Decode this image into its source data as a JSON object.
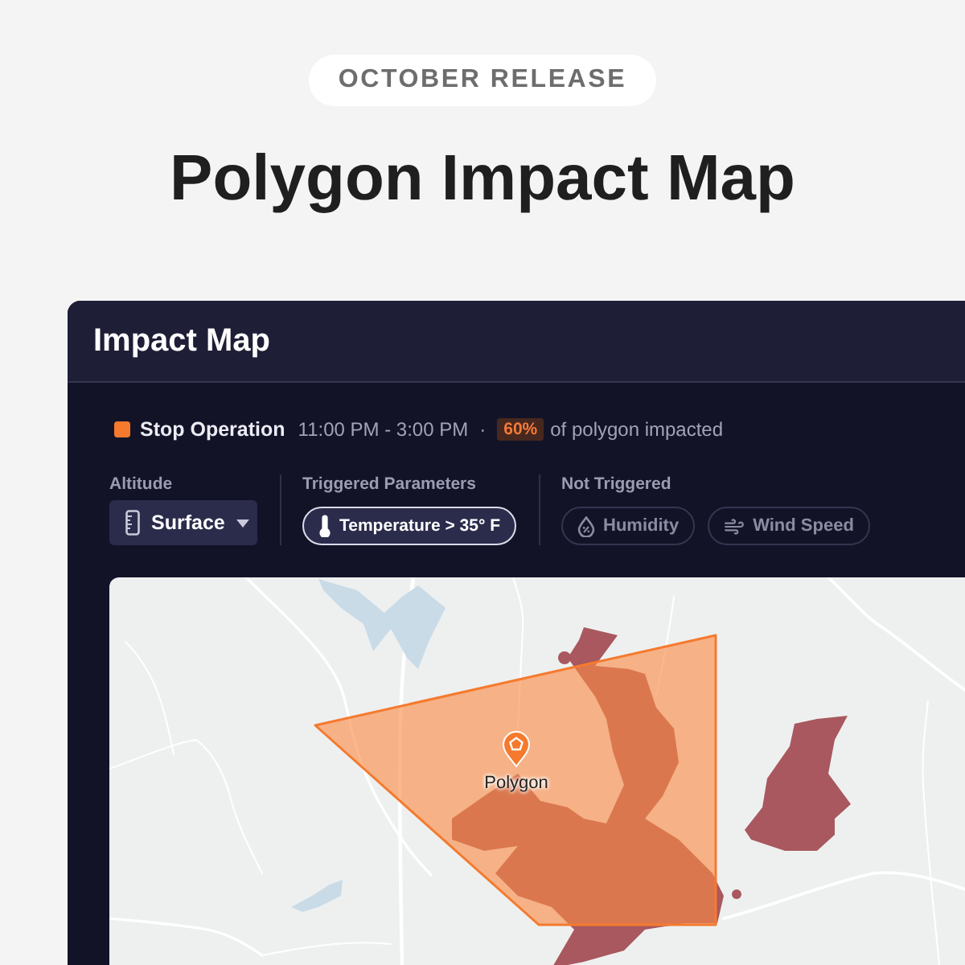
{
  "badge": "OCTOBER RELEASE",
  "headline": "Polygon Impact Map",
  "panel": {
    "title": "Impact Map",
    "status": {
      "label": "Stop Operation",
      "time": "11:00 PM - 3:00 PM",
      "separator": "·",
      "percent": "60%",
      "note": "of polygon impacted"
    },
    "filters": [
      {
        "kind": "dropdown",
        "label": "Altitude",
        "value": "Surface"
      },
      {
        "kind": "chips",
        "label": "Triggered Parameters",
        "chips": [
          {
            "kind": "temperature",
            "label": "Temperature > 35° F",
            "triggered": true
          }
        ]
      },
      {
        "kind": "chips",
        "label": "Not Triggered",
        "chips": [
          {
            "kind": "humidity",
            "label": "Humidity",
            "triggered": false
          },
          {
            "kind": "wind",
            "label": "Wind Speed",
            "triggered": false
          }
        ]
      }
    ],
    "map": {
      "marker_label": "Polygon"
    }
  }
}
